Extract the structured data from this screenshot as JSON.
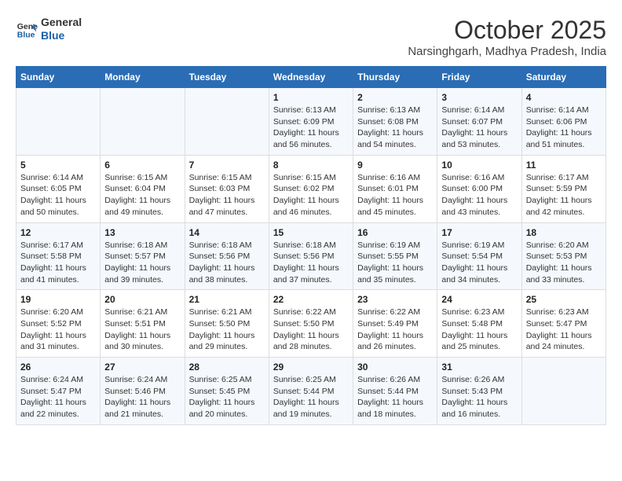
{
  "header": {
    "logo_line1": "General",
    "logo_line2": "Blue",
    "month": "October 2025",
    "location": "Narsinghgarh, Madhya Pradesh, India"
  },
  "days_of_week": [
    "Sunday",
    "Monday",
    "Tuesday",
    "Wednesday",
    "Thursday",
    "Friday",
    "Saturday"
  ],
  "weeks": [
    [
      {
        "day": "",
        "info": ""
      },
      {
        "day": "",
        "info": ""
      },
      {
        "day": "",
        "info": ""
      },
      {
        "day": "1",
        "info": "Sunrise: 6:13 AM\nSunset: 6:09 PM\nDaylight: 11 hours\nand 56 minutes."
      },
      {
        "day": "2",
        "info": "Sunrise: 6:13 AM\nSunset: 6:08 PM\nDaylight: 11 hours\nand 54 minutes."
      },
      {
        "day": "3",
        "info": "Sunrise: 6:14 AM\nSunset: 6:07 PM\nDaylight: 11 hours\nand 53 minutes."
      },
      {
        "day": "4",
        "info": "Sunrise: 6:14 AM\nSunset: 6:06 PM\nDaylight: 11 hours\nand 51 minutes."
      }
    ],
    [
      {
        "day": "5",
        "info": "Sunrise: 6:14 AM\nSunset: 6:05 PM\nDaylight: 11 hours\nand 50 minutes."
      },
      {
        "day": "6",
        "info": "Sunrise: 6:15 AM\nSunset: 6:04 PM\nDaylight: 11 hours\nand 49 minutes."
      },
      {
        "day": "7",
        "info": "Sunrise: 6:15 AM\nSunset: 6:03 PM\nDaylight: 11 hours\nand 47 minutes."
      },
      {
        "day": "8",
        "info": "Sunrise: 6:15 AM\nSunset: 6:02 PM\nDaylight: 11 hours\nand 46 minutes."
      },
      {
        "day": "9",
        "info": "Sunrise: 6:16 AM\nSunset: 6:01 PM\nDaylight: 11 hours\nand 45 minutes."
      },
      {
        "day": "10",
        "info": "Sunrise: 6:16 AM\nSunset: 6:00 PM\nDaylight: 11 hours\nand 43 minutes."
      },
      {
        "day": "11",
        "info": "Sunrise: 6:17 AM\nSunset: 5:59 PM\nDaylight: 11 hours\nand 42 minutes."
      }
    ],
    [
      {
        "day": "12",
        "info": "Sunrise: 6:17 AM\nSunset: 5:58 PM\nDaylight: 11 hours\nand 41 minutes."
      },
      {
        "day": "13",
        "info": "Sunrise: 6:18 AM\nSunset: 5:57 PM\nDaylight: 11 hours\nand 39 minutes."
      },
      {
        "day": "14",
        "info": "Sunrise: 6:18 AM\nSunset: 5:56 PM\nDaylight: 11 hours\nand 38 minutes."
      },
      {
        "day": "15",
        "info": "Sunrise: 6:18 AM\nSunset: 5:56 PM\nDaylight: 11 hours\nand 37 minutes."
      },
      {
        "day": "16",
        "info": "Sunrise: 6:19 AM\nSunset: 5:55 PM\nDaylight: 11 hours\nand 35 minutes."
      },
      {
        "day": "17",
        "info": "Sunrise: 6:19 AM\nSunset: 5:54 PM\nDaylight: 11 hours\nand 34 minutes."
      },
      {
        "day": "18",
        "info": "Sunrise: 6:20 AM\nSunset: 5:53 PM\nDaylight: 11 hours\nand 33 minutes."
      }
    ],
    [
      {
        "day": "19",
        "info": "Sunrise: 6:20 AM\nSunset: 5:52 PM\nDaylight: 11 hours\nand 31 minutes."
      },
      {
        "day": "20",
        "info": "Sunrise: 6:21 AM\nSunset: 5:51 PM\nDaylight: 11 hours\nand 30 minutes."
      },
      {
        "day": "21",
        "info": "Sunrise: 6:21 AM\nSunset: 5:50 PM\nDaylight: 11 hours\nand 29 minutes."
      },
      {
        "day": "22",
        "info": "Sunrise: 6:22 AM\nSunset: 5:50 PM\nDaylight: 11 hours\nand 28 minutes."
      },
      {
        "day": "23",
        "info": "Sunrise: 6:22 AM\nSunset: 5:49 PM\nDaylight: 11 hours\nand 26 minutes."
      },
      {
        "day": "24",
        "info": "Sunrise: 6:23 AM\nSunset: 5:48 PM\nDaylight: 11 hours\nand 25 minutes."
      },
      {
        "day": "25",
        "info": "Sunrise: 6:23 AM\nSunset: 5:47 PM\nDaylight: 11 hours\nand 24 minutes."
      }
    ],
    [
      {
        "day": "26",
        "info": "Sunrise: 6:24 AM\nSunset: 5:47 PM\nDaylight: 11 hours\nand 22 minutes."
      },
      {
        "day": "27",
        "info": "Sunrise: 6:24 AM\nSunset: 5:46 PM\nDaylight: 11 hours\nand 21 minutes."
      },
      {
        "day": "28",
        "info": "Sunrise: 6:25 AM\nSunset: 5:45 PM\nDaylight: 11 hours\nand 20 minutes."
      },
      {
        "day": "29",
        "info": "Sunrise: 6:25 AM\nSunset: 5:44 PM\nDaylight: 11 hours\nand 19 minutes."
      },
      {
        "day": "30",
        "info": "Sunrise: 6:26 AM\nSunset: 5:44 PM\nDaylight: 11 hours\nand 18 minutes."
      },
      {
        "day": "31",
        "info": "Sunrise: 6:26 AM\nSunset: 5:43 PM\nDaylight: 11 hours\nand 16 minutes."
      },
      {
        "day": "",
        "info": ""
      }
    ]
  ]
}
